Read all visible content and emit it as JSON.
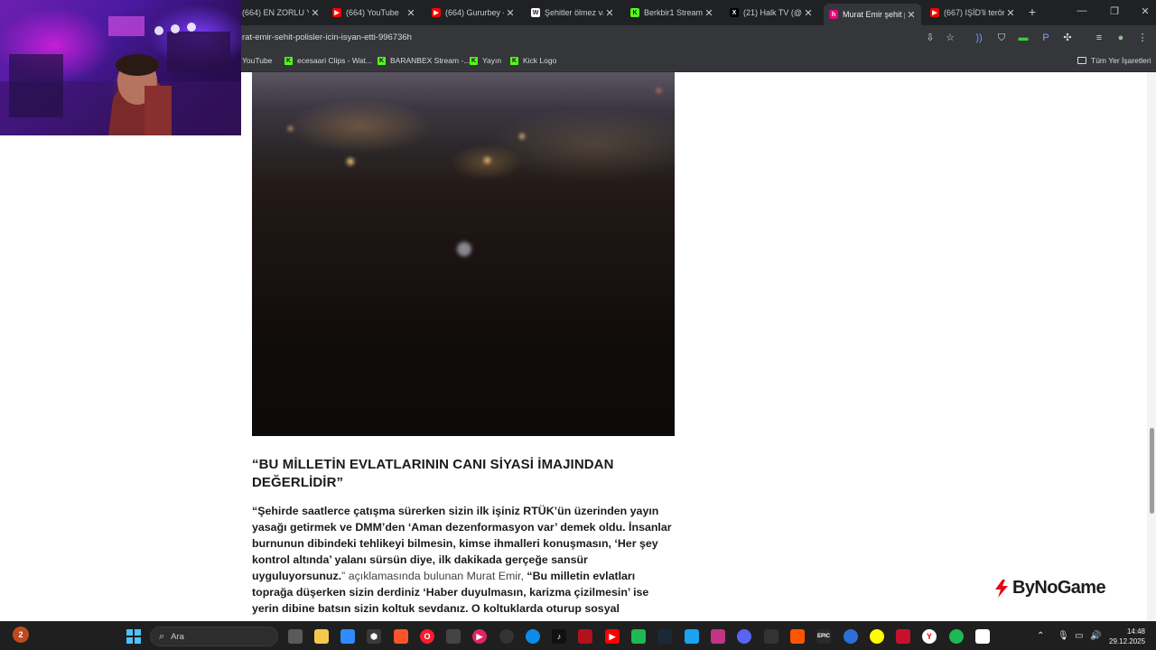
{
  "browser": {
    "tabs": [
      {
        "title": "(664) EN ZORLU Y",
        "icon": "youtube-icon",
        "color": "#ff0000",
        "active": false
      },
      {
        "title": "(664) YouTube",
        "icon": "youtube-icon",
        "color": "#ff0000",
        "active": false
      },
      {
        "title": "(664) Gururbey - K",
        "icon": "youtube-icon",
        "color": "#ff0000",
        "active": false
      },
      {
        "title": "Şehitler ölmez vat",
        "icon": "w-icon",
        "color": "#ffffff",
        "active": false
      },
      {
        "title": "Berkbir1 Stream -",
        "icon": "kick-icon",
        "color": "#53fc18",
        "active": false
      },
      {
        "title": "(21) Halk TV (@h",
        "icon": "x-icon",
        "color": "#000000",
        "active": false
      },
      {
        "title": "Murat Emir şehit p",
        "icon": "news-icon",
        "color": "#e6007e",
        "active": true
      },
      {
        "title": "(667) IŞİD'li terör",
        "icon": "youtube-icon",
        "color": "#ff0000",
        "active": false
      }
    ],
    "url": "rat-emir-sehit-polisler-icin-isyan-etti-996736h",
    "bookmarks": [
      {
        "label": "YouTube",
        "type": "youtube"
      },
      {
        "label": "ecesaari Clips - Wat...",
        "type": "kick"
      },
      {
        "label": "BARANBEX Stream -...",
        "type": "kick"
      },
      {
        "label": "Yayın",
        "type": "kick"
      },
      {
        "label": "Kick Logo",
        "type": "kick"
      }
    ],
    "all_bookmarks": "Tüm Yer İşaretleri"
  },
  "article": {
    "heading": "“BU MİLLETİN EVLATLARININ CANI SİYASİ İMAJINDAN DEĞERLİDİR”",
    "para_bold_1": "“Şehirde saatlerce çatışma sürerken sizin ilk işiniz RTÜK’ün üzerinden yayın yasağı getirmek ve DMM’den ‘Aman dezenformasyon var’ demek oldu. İnsanlar burnunun dibindeki tehlikeyi bilmesin, kimse ihmalleri konuşmasın, ‘Her şey kontrol altında’ yalanı sürsün diye, ilk dakikada gerçeğe sansür uyguluyorsunuz.",
    "para_normal": "” açıklamasında bulunan Murat Emir, ",
    "para_bold_2": "“Bu milletin evlatları toprağa düşerken sizin derdiniz ‘Haber duyulmasın, karizma çizilmesin’ ise yerin dibine batsın sizin koltuk sevdanız. O koltuklarda oturup sosyal"
  },
  "watermark": "ByNoGame",
  "taskbar": {
    "search_placeholder": "Ara",
    "time": "14:48",
    "date": "29.12.2025",
    "notification_count": "2"
  }
}
